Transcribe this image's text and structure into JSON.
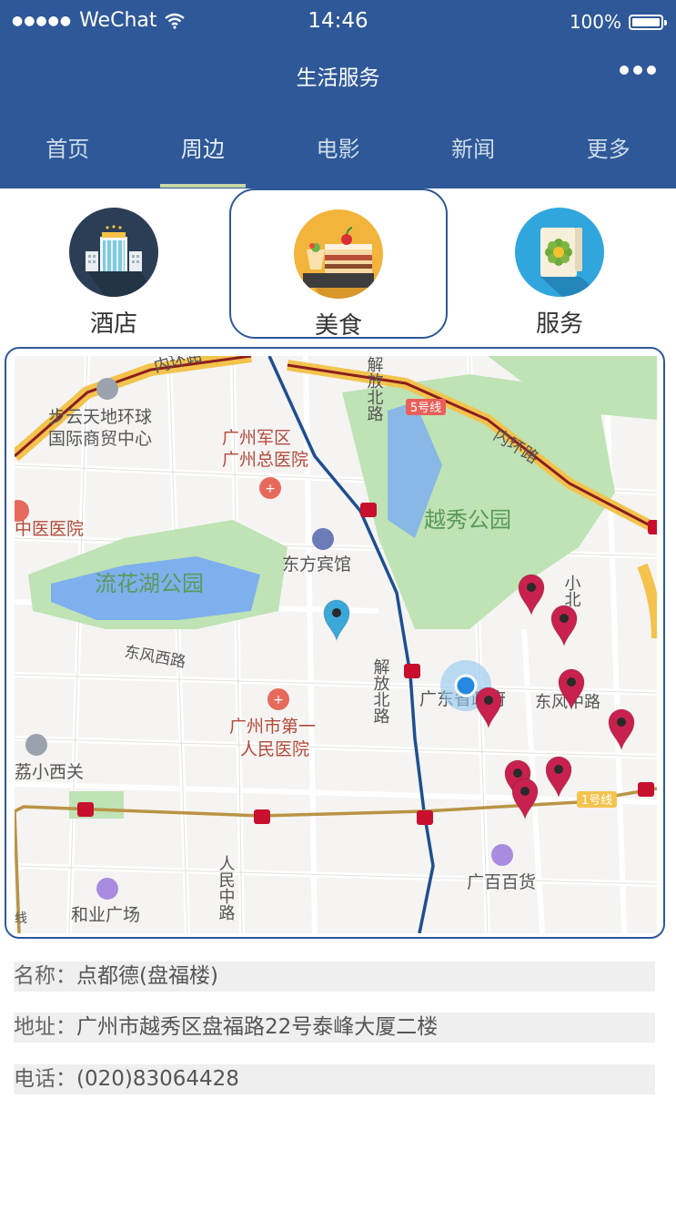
{
  "status_bar": {
    "signal_dots": "●●●●●",
    "carrier": "WeChat",
    "time": "14:46",
    "battery": "100%"
  },
  "nav": {
    "title": "生活服务"
  },
  "tabs": [
    {
      "label": "首页",
      "active": false
    },
    {
      "label": "周边",
      "active": true
    },
    {
      "label": "电影",
      "active": false
    },
    {
      "label": "新闻",
      "active": false
    },
    {
      "label": "更多",
      "active": false
    }
  ],
  "categories": [
    {
      "label": "酒店",
      "icon": "hotel-icon"
    },
    {
      "label": "美食",
      "icon": "food-icon",
      "selected": true
    },
    {
      "label": "服务",
      "icon": "service-icon"
    }
  ],
  "map": {
    "labels": {
      "inner_ring_top": "内环路",
      "inner_ring_right": "内环路",
      "jiefang_n_top": "解放北路",
      "line5": "5号线",
      "line1": "1号线",
      "buyun": "步云天地环球",
      "buyun2": "国际商贸中心",
      "army": "广州军区",
      "army2": "广州总医院",
      "yuexiu": "越秀公园",
      "tcm": "中医医院",
      "dongfang": "东方宾馆",
      "liuhua": "流花湖公园",
      "dongfeng_w": "东风西路",
      "jiefang_n": "解放北路",
      "gov": "广东省政府",
      "dongfeng_m": "东风中路",
      "xiaobei": "小北",
      "hosp1": "广州市第一",
      "hosp2": "人民医院",
      "xiguan": "荔小西关",
      "guangbai": "广百百货",
      "renmin": "人民中路",
      "heye": "和业广场",
      "xian": "线"
    }
  },
  "info": {
    "name_label": "名称：",
    "name": "点都德(盘福楼)",
    "address_label": "地址：",
    "address": "广州市越秀区盘福路22号泰峰大厦二楼",
    "phone_label": "电话：",
    "phone": "(020)83064428"
  },
  "colors": {
    "primary": "#2e5898",
    "pin_red": "#c8214e",
    "pin_blue": "#3aa8d8",
    "park_green": "#bfe3b4",
    "water": "#7fb0ee",
    "ring_road": "#f3c34d",
    "metro_blue": "#1e4f8f",
    "metro_gold": "#b99445"
  }
}
